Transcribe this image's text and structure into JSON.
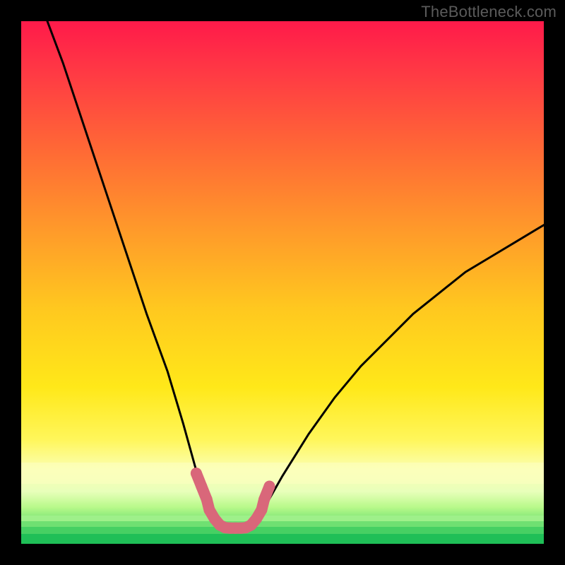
{
  "watermark": "TheBottleneck.com",
  "colors": {
    "top": "#ff1a4a",
    "mid": "#ffd200",
    "lowband": "#f9ffb0",
    "green1": "#b8f98a",
    "green2": "#5bd66a",
    "green3": "#1fbf57",
    "curve": "#000000",
    "marker": "#d9677a",
    "bg": "#000000"
  },
  "chart_data": {
    "type": "line",
    "title": "",
    "xlabel": "",
    "ylabel": "",
    "xlim": [
      0,
      100
    ],
    "ylim": [
      0,
      100
    ],
    "series": [
      {
        "name": "bottleneck-curve",
        "x": [
          5,
          8,
          12,
          16,
          20,
          24,
          28,
          31,
          33.5,
          36,
          38,
          40,
          44,
          46,
          50,
          55,
          60,
          65,
          70,
          75,
          80,
          85,
          90,
          95,
          100
        ],
        "y": [
          100,
          92,
          80,
          68,
          56,
          44,
          33,
          23,
          14,
          6,
          3,
          3,
          3,
          6,
          13,
          21,
          28,
          34,
          39,
          44,
          48,
          52,
          55,
          58,
          61
        ]
      }
    ],
    "markers": {
      "name": "highlighted-range",
      "x": [
        33.5,
        34.5,
        35.5,
        36,
        37,
        38,
        39,
        40,
        41,
        42,
        43,
        44,
        45,
        46,
        46.5,
        47.5
      ],
      "y": [
        13.5,
        11,
        8.5,
        6.5,
        4.8,
        3.6,
        3.1,
        3,
        3,
        3,
        3.1,
        3.6,
        4.8,
        6.5,
        8.5,
        11
      ]
    },
    "annotations": []
  }
}
